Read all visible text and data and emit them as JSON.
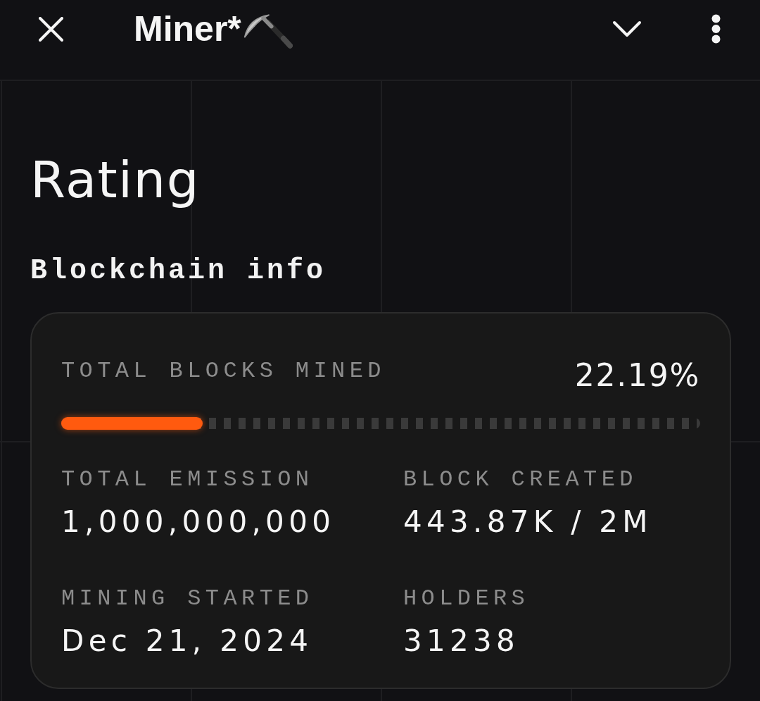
{
  "header": {
    "title": "Miner*"
  },
  "page": {
    "title": "Rating",
    "subtitle": "Blockchain info"
  },
  "card": {
    "progress": {
      "label": "TOTAL BLOCKS MINED",
      "reading": "22.19%",
      "level": 0.2219
    },
    "stats": [
      {
        "label": "TOTAL EMISSION",
        "value": "1,000,000,000"
      },
      {
        "label": "BLOCK CREATED",
        "value": "443.87K / 2M"
      },
      {
        "label": "MINING STARTED",
        "value": "Dec 21, 2024"
      },
      {
        "label": "HOLDERS",
        "value": "31238"
      }
    ]
  }
}
